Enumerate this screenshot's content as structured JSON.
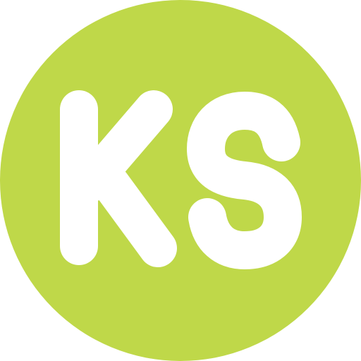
{
  "logo": {
    "text": "KS",
    "colors": {
      "background_circle": "#bfd849",
      "letters": "#ffffff",
      "page": "#ffffff"
    }
  }
}
